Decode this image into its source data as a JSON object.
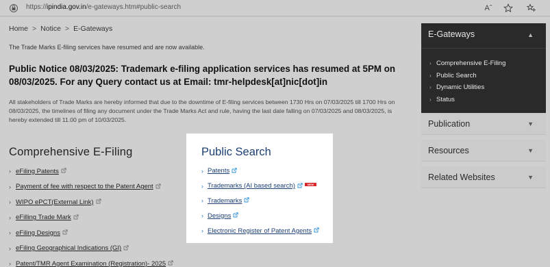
{
  "browser": {
    "url_prefix": "https://",
    "url_host": "ipindia.gov.in",
    "url_path": "/e-gateways.htm#public-search",
    "read_aloud_label": "Aˆ",
    "favorite_icon": "star-icon",
    "collections_icon": "collections-icon"
  },
  "breadcrumb": {
    "items": [
      "Home",
      "Notice",
      "E-Gateways"
    ],
    "separator": ">"
  },
  "announcement": "The Trade Marks E-filing services have resumed and are now available.",
  "notice": {
    "heading": "Public Notice 08/03/2025: Trademark e-filing application services has resumed at 5PM on 08/03/2025. For any Query contact us at Email: tmr-helpdesk[at]nic[dot]in",
    "body": "All stakeholders of Trade Marks are hereby informed that due to the downtime of E-filing services between 1730 Hrs on 07/03/2025 till 1700 Hrs on 08/03/2025, the  timelines of filing any document under the Trade Marks Act and rule, having the last date falling on 07/03/2025 and 08/03/2025, is hereby extended till 11.00 pm of 10/03/2025."
  },
  "comprehensive_efiling": {
    "title": "Comprehensive E-Filing",
    "items": [
      {
        "label": "eFiling Patents"
      },
      {
        "label": "Payment of fee with respect to the Patent Agent"
      },
      {
        "label": "WIPO ePCT(External Link)"
      },
      {
        "label": "eFilling Trade Mark"
      },
      {
        "label": "eFiling Designs"
      },
      {
        "label": "eFiling Geographical Indications (GI)"
      },
      {
        "label": "Patent/TMR Agent Examination (Registration)- 2025"
      }
    ]
  },
  "public_search": {
    "title": "Public Search",
    "items": [
      {
        "label": "Patents"
      },
      {
        "label": "Trademarks (AI based search)",
        "badge": "NEW"
      },
      {
        "label": "Trademarks"
      },
      {
        "label": "Designs"
      },
      {
        "label": "Electronic Register of Patent Agents"
      }
    ]
  },
  "sidebar": {
    "gateways": {
      "title": "E-Gateways",
      "items": [
        {
          "label": "Comprehensive E-Filing"
        },
        {
          "label": "Public Search"
        },
        {
          "label": "Dynamic Utilities"
        },
        {
          "label": "Status"
        }
      ]
    },
    "accordions": [
      {
        "label": "Publication"
      },
      {
        "label": "Resources"
      },
      {
        "label": "Related Websites"
      }
    ]
  },
  "colors": {
    "overlay_grey": "#cfcfcf",
    "popup_bg": "#ffffff",
    "link_blue": "#1c3f74",
    "sidebar_dark": "#2a2a2a",
    "new_badge_red": "#d9262b"
  }
}
